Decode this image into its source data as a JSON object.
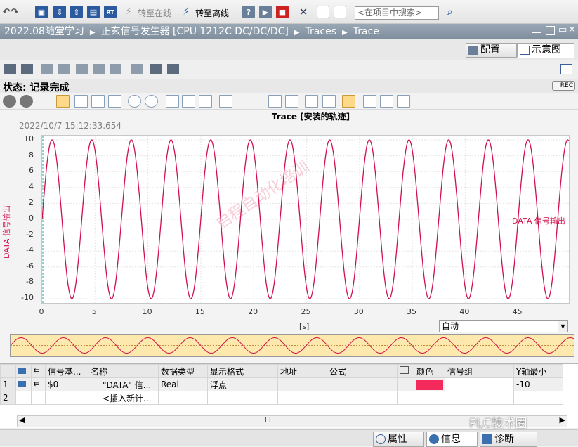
{
  "toolbar": {
    "go_online": "转至在线",
    "go_offline": "转至离线",
    "search_placeholder": "<在项目中搜索>"
  },
  "titlebar": {
    "breadcrumb": [
      "2022.08随堂学习",
      "正玄信号发生器 [CPU 1212C DC/DC/DC]",
      "Traces",
      "Trace"
    ]
  },
  "tabs": {
    "config": "配置",
    "diagram": "示意图"
  },
  "status": {
    "text": "状态: 记录完成",
    "rec": "REC"
  },
  "chart": {
    "title": "Trace [安装的轨迹]",
    "timestamp": "2022/10/7 15:12:33.654",
    "ylabel": "DATA 信号输出",
    "series_label": "DATA 信号输出",
    "xunit": "[s]",
    "watermark": "启程自动化培训",
    "autoscale": "自动",
    "yticks": [
      "10",
      "8",
      "6",
      "4",
      "2",
      "0",
      "-2",
      "-4",
      "-6",
      "-8",
      "-10"
    ],
    "xticks": [
      "0",
      "5",
      "10",
      "15",
      "20",
      "25",
      "30",
      "35",
      "40",
      "45"
    ]
  },
  "chart_data": {
    "type": "line",
    "xlabel": "[s]",
    "ylabel": "DATA 信号输出",
    "xlim": [
      0,
      50
    ],
    "ylim": [
      -10,
      10
    ],
    "series": [
      {
        "name": "DATA 信号输出",
        "color": "#d0104c",
        "function": "sine",
        "amplitude": 10,
        "period_s": 3.75,
        "phase_start": 0,
        "x_end": 49.8
      }
    ],
    "grid": true
  },
  "table": {
    "headers": [
      "",
      "",
      "信号基...",
      "名称",
      "数据类型",
      "显示格式",
      "地址",
      "公式",
      "",
      "颜色",
      "信号组",
      "Y轴最小"
    ],
    "rows": [
      {
        "num": "1",
        "signal": "$0",
        "name": "\"DATA\" 信...",
        "type": "Real",
        "format": "浮点",
        "color": "#f52a5c",
        "ymin": "-10"
      },
      {
        "num": "2",
        "signal": "",
        "name": "<插入新计...",
        "type": "",
        "format": "",
        "color": "",
        "ymin": ""
      }
    ],
    "scroll_thumb": "III"
  },
  "bottom": {
    "properties": "属性",
    "info": "信息",
    "diagnostics": "诊断",
    "watermark": "PLC技术圈"
  }
}
